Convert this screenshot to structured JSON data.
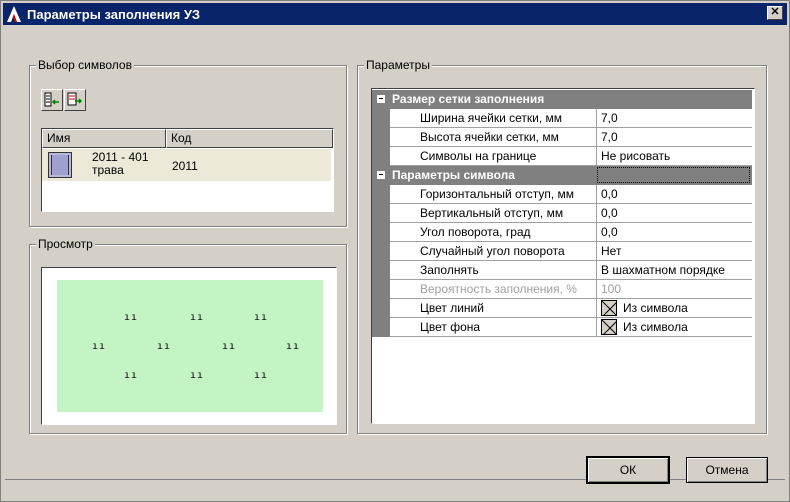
{
  "window": {
    "title": "Параметры заполнения УЗ"
  },
  "symbols_group": {
    "title": "Выбор символов",
    "toolbar": [
      "add-symbol-icon",
      "remove-symbol-icon"
    ],
    "columns": [
      "Имя",
      "Код"
    ],
    "rows": [
      {
        "name_line1": "2011 - 401",
        "name_line2": "трава",
        "code": "2011"
      }
    ]
  },
  "preview_group": {
    "title": "Просмотр",
    "fill_color": "#c4f3c4",
    "glyph": "ıı"
  },
  "params_group": {
    "title": "Параметры",
    "categories": {
      "grid": "Размер сетки заполнения",
      "symbol": "Параметры символа"
    },
    "grid_rows": [
      {
        "name": "Ширина ячейки сетки, мм",
        "value": "7,0"
      },
      {
        "name": "Высота ячейки сетки, мм",
        "value": "7,0"
      },
      {
        "name": "Символы на границе",
        "value": "Не рисовать"
      }
    ],
    "symbol_rows": [
      {
        "name": "Горизонтальный отступ, мм",
        "value": "0,0"
      },
      {
        "name": "Вертикальный отступ, мм",
        "value": "0,0"
      },
      {
        "name": "Угол поворота, град",
        "value": "0,0"
      },
      {
        "name": "Случайный угол поворота",
        "value": "Нет"
      },
      {
        "name": "Заполнять",
        "value": "В шахматном порядке"
      },
      {
        "name": "Вероятность заполнения, %",
        "value": "100"
      },
      {
        "name": "Цвет линий",
        "value": "Из символа"
      },
      {
        "name": "Цвет фона",
        "value": "Из символа"
      }
    ]
  },
  "buttons": {
    "ok": "ОК",
    "cancel": "Отмена"
  }
}
